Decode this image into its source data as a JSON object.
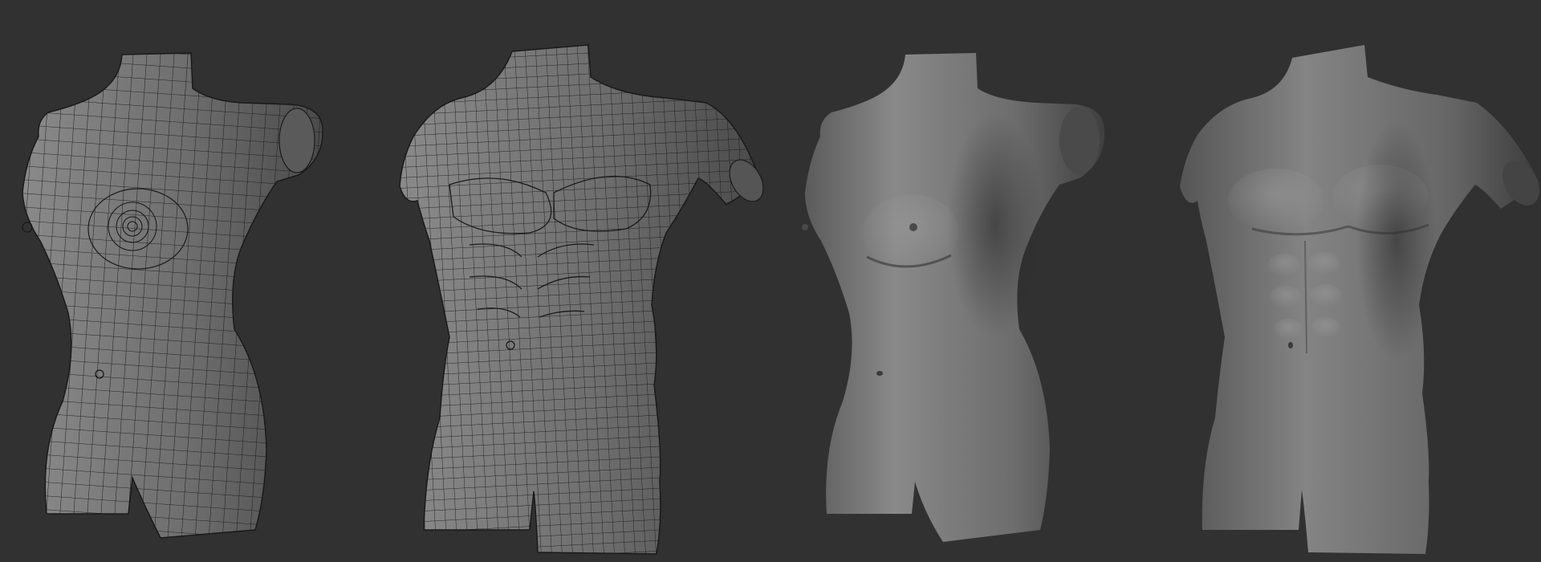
{
  "viewport": {
    "background": "#313131"
  },
  "models": [
    {
      "label": "female-torso",
      "display": "wireframe",
      "surface_color": "#6f6f6f",
      "wire_color": "#141414"
    },
    {
      "label": "male-torso",
      "display": "wireframe",
      "surface_color": "#6f6f6f",
      "wire_color": "#141414"
    },
    {
      "label": "female-torso",
      "display": "shaded",
      "surface_color": "#7a7a7a"
    },
    {
      "label": "male-torso",
      "display": "shaded",
      "surface_color": "#757575"
    }
  ]
}
